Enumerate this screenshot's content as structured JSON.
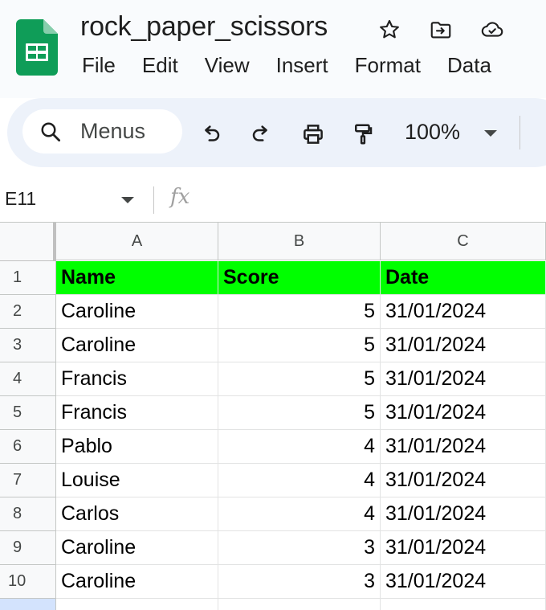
{
  "app": {
    "document_title": "rock_paper_scissors",
    "menu": [
      "File",
      "Edit",
      "View",
      "Insert",
      "Format",
      "Data"
    ],
    "icons": {
      "logo": "sheets-logo-icon",
      "star": "star-icon",
      "move": "move-to-folder-icon",
      "cloud": "cloud-saved-icon"
    },
    "colors": {
      "logo_green": "#0f9d58",
      "header_fill": "#00ff00",
      "toolbar_bg": "#edf2fa"
    }
  },
  "toolbar": {
    "search_label": "Menus",
    "zoom": "100%",
    "icons": [
      "search-icon",
      "undo-icon",
      "redo-icon",
      "print-icon",
      "paint-format-icon",
      "chevron-down-icon"
    ]
  },
  "formula_bar": {
    "name_box": "E11",
    "fx_label": "fx"
  },
  "sheet": {
    "columns": [
      "A",
      "B",
      "C"
    ],
    "rows": [
      {
        "num": "1",
        "name": "Name",
        "score": "Score",
        "date": "Date"
      },
      {
        "num": "2",
        "name": "Caroline",
        "score": "5",
        "date": "31/01/2024"
      },
      {
        "num": "3",
        "name": "Caroline",
        "score": "5",
        "date": "31/01/2024"
      },
      {
        "num": "4",
        "name": "Francis",
        "score": "5",
        "date": "31/01/2024"
      },
      {
        "num": "5",
        "name": "Francis",
        "score": "5",
        "date": "31/01/2024"
      },
      {
        "num": "6",
        "name": "Pablo",
        "score": "4",
        "date": "31/01/2024"
      },
      {
        "num": "7",
        "name": "Louise",
        "score": "4",
        "date": "31/01/2024"
      },
      {
        "num": "8",
        "name": "Carlos",
        "score": "4",
        "date": "31/01/2024"
      },
      {
        "num": "9",
        "name": "Caroline",
        "score": "3",
        "date": "31/01/2024"
      },
      {
        "num": "10",
        "name": "Caroline",
        "score": "3",
        "date": "31/01/2024"
      }
    ]
  }
}
